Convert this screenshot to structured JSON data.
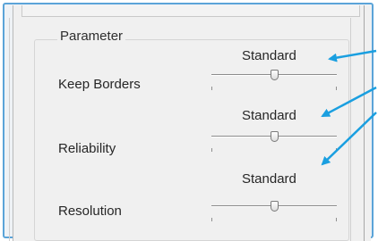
{
  "group": {
    "title": "Parameter"
  },
  "params": [
    {
      "label": "Keep Borders",
      "value": "Standard"
    },
    {
      "label": "Reliability",
      "value": "Standard"
    },
    {
      "label": "Resolution",
      "value": "Standard"
    }
  ],
  "colors": {
    "annotation_arrow": "#1a9fe0",
    "frame_border": "#5ba4d8"
  }
}
